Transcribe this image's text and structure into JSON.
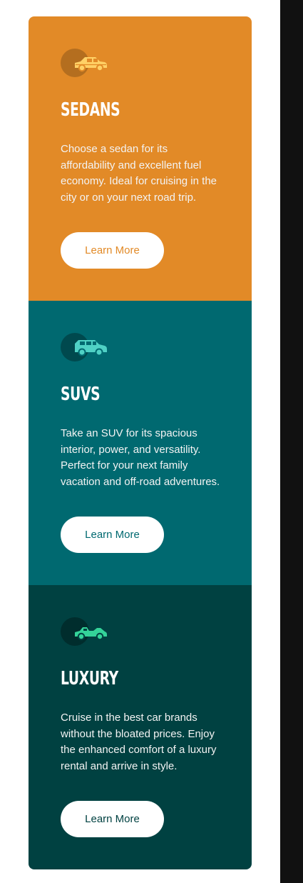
{
  "cards": [
    {
      "id": "sedans",
      "title": "Sedans",
      "description": "Choose a sedan for its affordability and excellent fuel economy. Ideal for cruising in the city or on your next road trip.",
      "button_label": "Learn More",
      "icon": "sedan-car-icon",
      "background_color": "#E28A27",
      "icon_color": "#FFD166"
    },
    {
      "id": "suvs",
      "title": "SUVs",
      "description": "Take an SUV for its spacious interior, power, and versatility. Perfect for your next family vacation and off-road adventures.",
      "button_label": "Learn More",
      "icon": "suv-car-icon",
      "background_color": "#006970",
      "icon_color": "#4FD1C5"
    },
    {
      "id": "luxury",
      "title": "Luxury",
      "description": "Cruise in the best car brands without the bloated prices. Enjoy the enhanced comfort of a luxury rental and arrive in style.",
      "button_label": "Learn More",
      "icon": "luxury-car-icon",
      "background_color": "#004141",
      "icon_color": "#34D399"
    }
  ]
}
